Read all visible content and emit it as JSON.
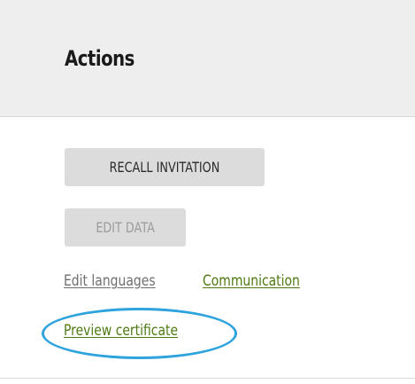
{
  "header": {
    "title": "Actions"
  },
  "buttons": {
    "recall_invitation": "RECALL INVITATION",
    "edit_data": "EDIT DATA"
  },
  "links": {
    "edit_languages": "Edit languages",
    "communication": "Communication",
    "preview_certificate": "Preview certificate"
  },
  "colors": {
    "header_bg": "#eeeeee",
    "button_bg": "#dcdcdc",
    "link_green": "#4e7a12",
    "link_gray": "#6f6f6f",
    "disabled_text": "#9c9c9c",
    "highlight_ring": "#2ea3dd"
  },
  "state": {
    "edit_data_disabled": true,
    "highlighted_link": "preview_certificate"
  }
}
